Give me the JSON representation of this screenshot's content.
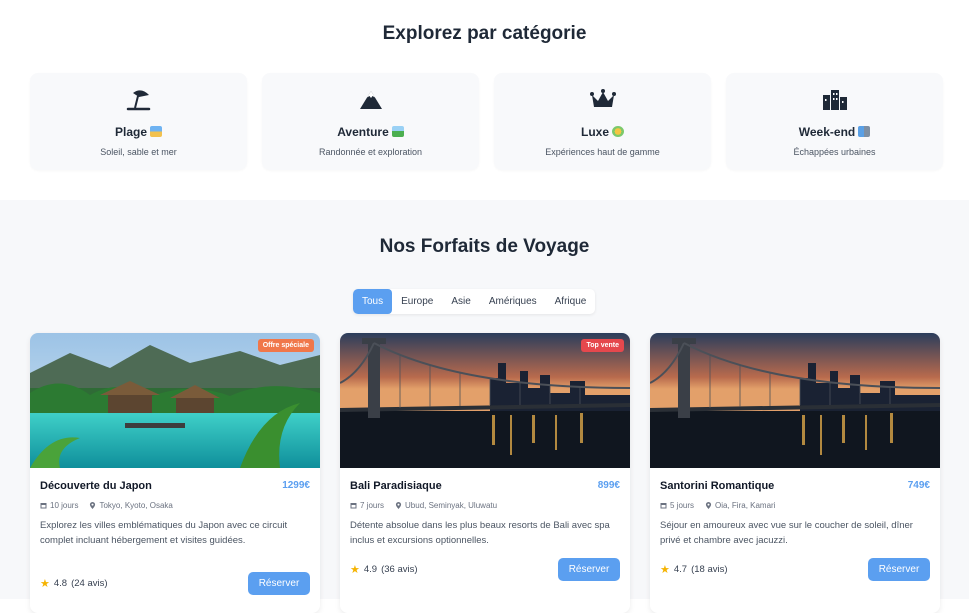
{
  "categories_section": {
    "title": "Explorez par catégorie",
    "items": [
      {
        "name": "Plage",
        "description": "Soleil, sable et mer",
        "icon": "umbrella-beach-icon"
      },
      {
        "name": "Aventure",
        "description": "Randonnée et exploration",
        "icon": "mountain-icon"
      },
      {
        "name": "Luxe",
        "description": "Expériences haut de gamme",
        "icon": "crown-icon"
      },
      {
        "name": "Week-end",
        "description": "Échappées urbaines",
        "icon": "city-icon"
      }
    ]
  },
  "packages_section": {
    "title": "Nos Forfaits de Voyage",
    "filters": [
      "Tous",
      "Europe",
      "Asie",
      "Amériques",
      "Afrique"
    ],
    "active_filter": "Tous",
    "packages": [
      {
        "title": "Découverte du Japon",
        "price": "1299€",
        "badge": "Offre spéciale",
        "duration": "10 jours",
        "locations": "Tokyo, Kyoto, Osaka",
        "description": "Explorez les villes emblématiques du Japon avec ce circuit complet incluant hébergement et visites guidées.",
        "rating": "4.8",
        "reviews": "(24 avis)",
        "button": "Réserver",
        "image": "tropical-resort-pool"
      },
      {
        "title": "Bali Paradisiaque",
        "price": "899€",
        "badge": "Top vente",
        "duration": "7 jours",
        "locations": "Ubud, Seminyak, Uluwatu",
        "description": "Détente absolue dans les plus beaux resorts de Bali avec spa inclus et excursions optionnelles.",
        "rating": "4.9",
        "reviews": "(36 avis)",
        "button": "Réserver",
        "image": "city-bridge-night"
      },
      {
        "title": "Santorini Romantique",
        "price": "749€",
        "badge": "",
        "duration": "5 jours",
        "locations": "Oia, Fira, Kamari",
        "description": "Séjour en amoureux avec vue sur le coucher de soleil, dîner privé et chambre avec jacuzzi.",
        "rating": "4.7",
        "reviews": "(18 avis)",
        "button": "Réserver",
        "image": "city-bridge-night"
      }
    ]
  },
  "colors": {
    "accent": "#5b9ff0",
    "badge_orange": "#f0774a",
    "badge_red": "#e5484d",
    "star": "#f5b301"
  }
}
